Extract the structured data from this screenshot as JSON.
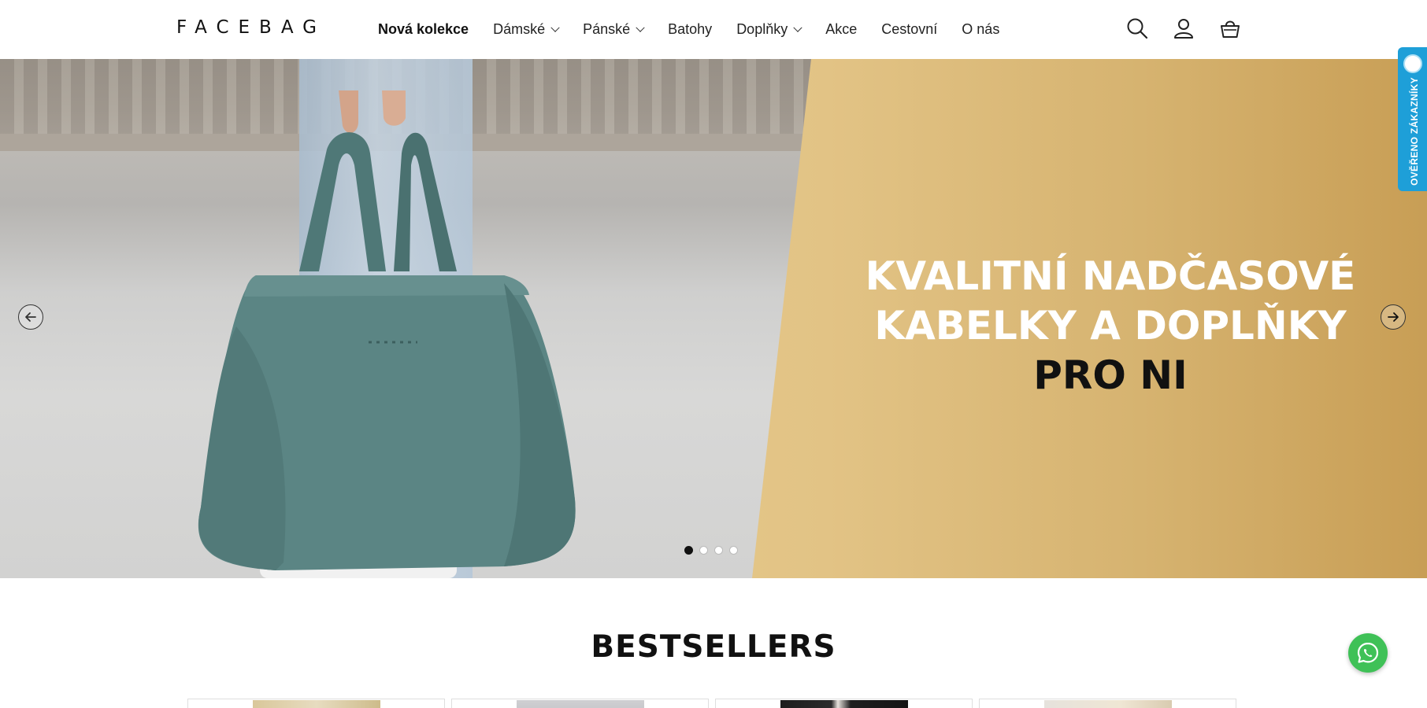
{
  "header": {
    "logo": "FACEBAG",
    "nav": [
      {
        "label": "Nová kolekce",
        "dropdown": false,
        "active": true
      },
      {
        "label": "Dámské",
        "dropdown": true
      },
      {
        "label": "Pánské",
        "dropdown": true
      },
      {
        "label": "Batohy",
        "dropdown": false
      },
      {
        "label": "Doplňky",
        "dropdown": true
      },
      {
        "label": "Akce",
        "dropdown": false
      },
      {
        "label": "Cestovní",
        "dropdown": false
      },
      {
        "label": "O nás",
        "dropdown": false
      }
    ],
    "icons": [
      "search-icon",
      "account-icon",
      "cart-icon"
    ]
  },
  "hero": {
    "headline_line1": "KVALITNÍ NADČASOVÉ",
    "headline_line2": "KABELKY A DOPLŇKY",
    "headline_line3": "PRO NI",
    "slide_count": 4,
    "active_slide": 1,
    "colors": {
      "gold": "#dcbd7c",
      "bag": "#5b8584",
      "headline_light": "#ffffff",
      "headline_dark": "#111111"
    }
  },
  "verified_badge": {
    "label": "OVĚŘENO ZÁKAZNÍKY",
    "color": "#1e9fd8"
  },
  "bestsellers": {
    "title": "BESTSELLERS",
    "card_count": 4
  },
  "whatsapp": {
    "icon": "whatsapp-icon",
    "color": "#3fc157"
  }
}
